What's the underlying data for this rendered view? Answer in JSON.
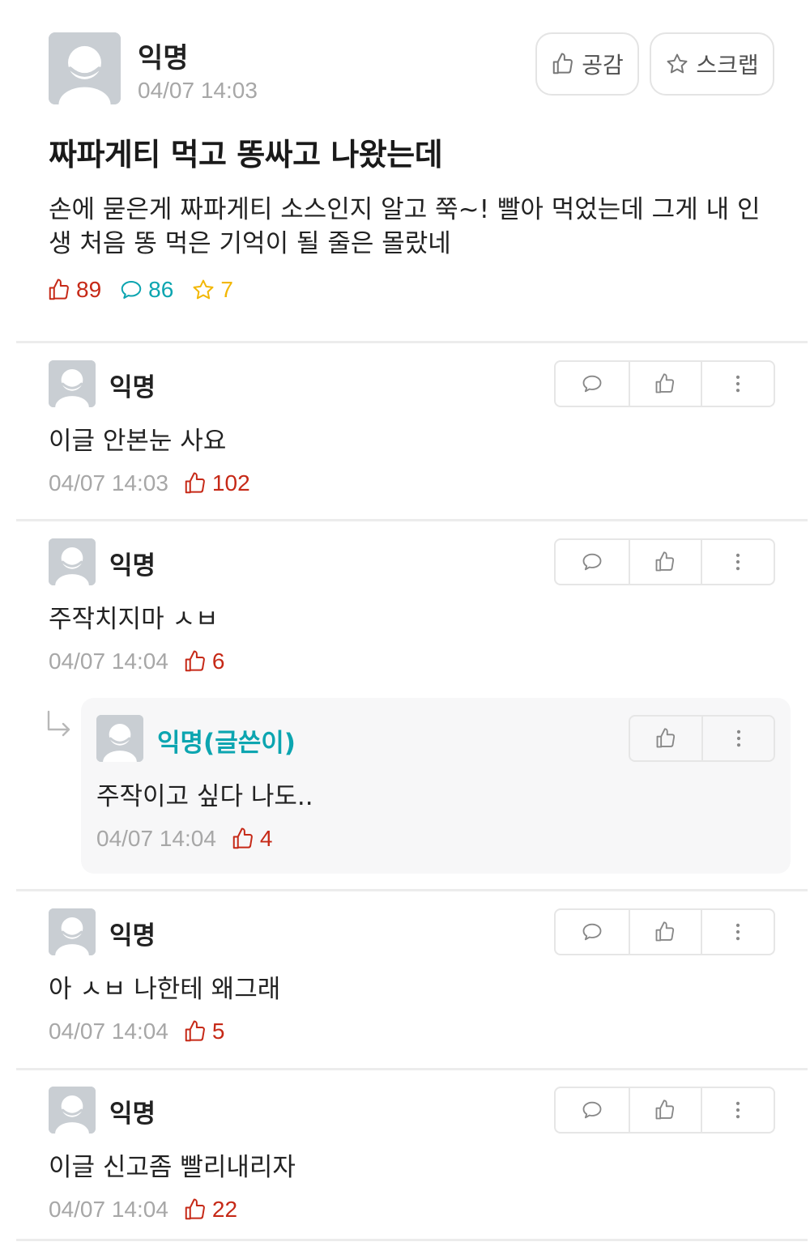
{
  "post": {
    "author": "익명",
    "time": "04/07 14:03",
    "like_button": "공감",
    "scrap_button": "스크랩",
    "title": "짜파게티 먹고 똥싸고 나왔는데",
    "body": "손에 묻은게 짜파게티 소스인지 알고 쭉~! 빨아 먹었는데 그게 내 인생 처음 똥 먹은 기억이 될 줄은 몰랐네",
    "stats": {
      "likes": "89",
      "comments": "86",
      "scraps": "7"
    }
  },
  "comments": [
    {
      "author": "익명",
      "text": "이글 안본눈 사요",
      "time": "04/07 14:03",
      "likes": "102"
    },
    {
      "author": "익명",
      "text": "주작치지마 ㅅㅂ",
      "time": "04/07 14:04",
      "likes": "6"
    },
    {
      "author": "익명",
      "text": "아 ㅅㅂ 나한테 왜그래",
      "time": "04/07 14:04",
      "likes": "5"
    },
    {
      "author": "익명",
      "text": "이글 신고좀 빨리내리자",
      "time": "04/07 14:04",
      "likes": "22"
    }
  ],
  "reply": {
    "author": "익명(글쓴이)",
    "text": "주작이고 싶다 나도..",
    "time": "04/07 14:04",
    "likes": "4"
  },
  "colors": {
    "like": "#c62917",
    "comment": "#0ca5b0",
    "scrap": "#f2b705",
    "meta": "#a7a7a7"
  },
  "icons": [
    "thumbs-up-icon",
    "star-icon",
    "speech-bubble-icon",
    "more-vertical-icon",
    "reply-arrow-icon",
    "default-avatar-icon"
  ]
}
